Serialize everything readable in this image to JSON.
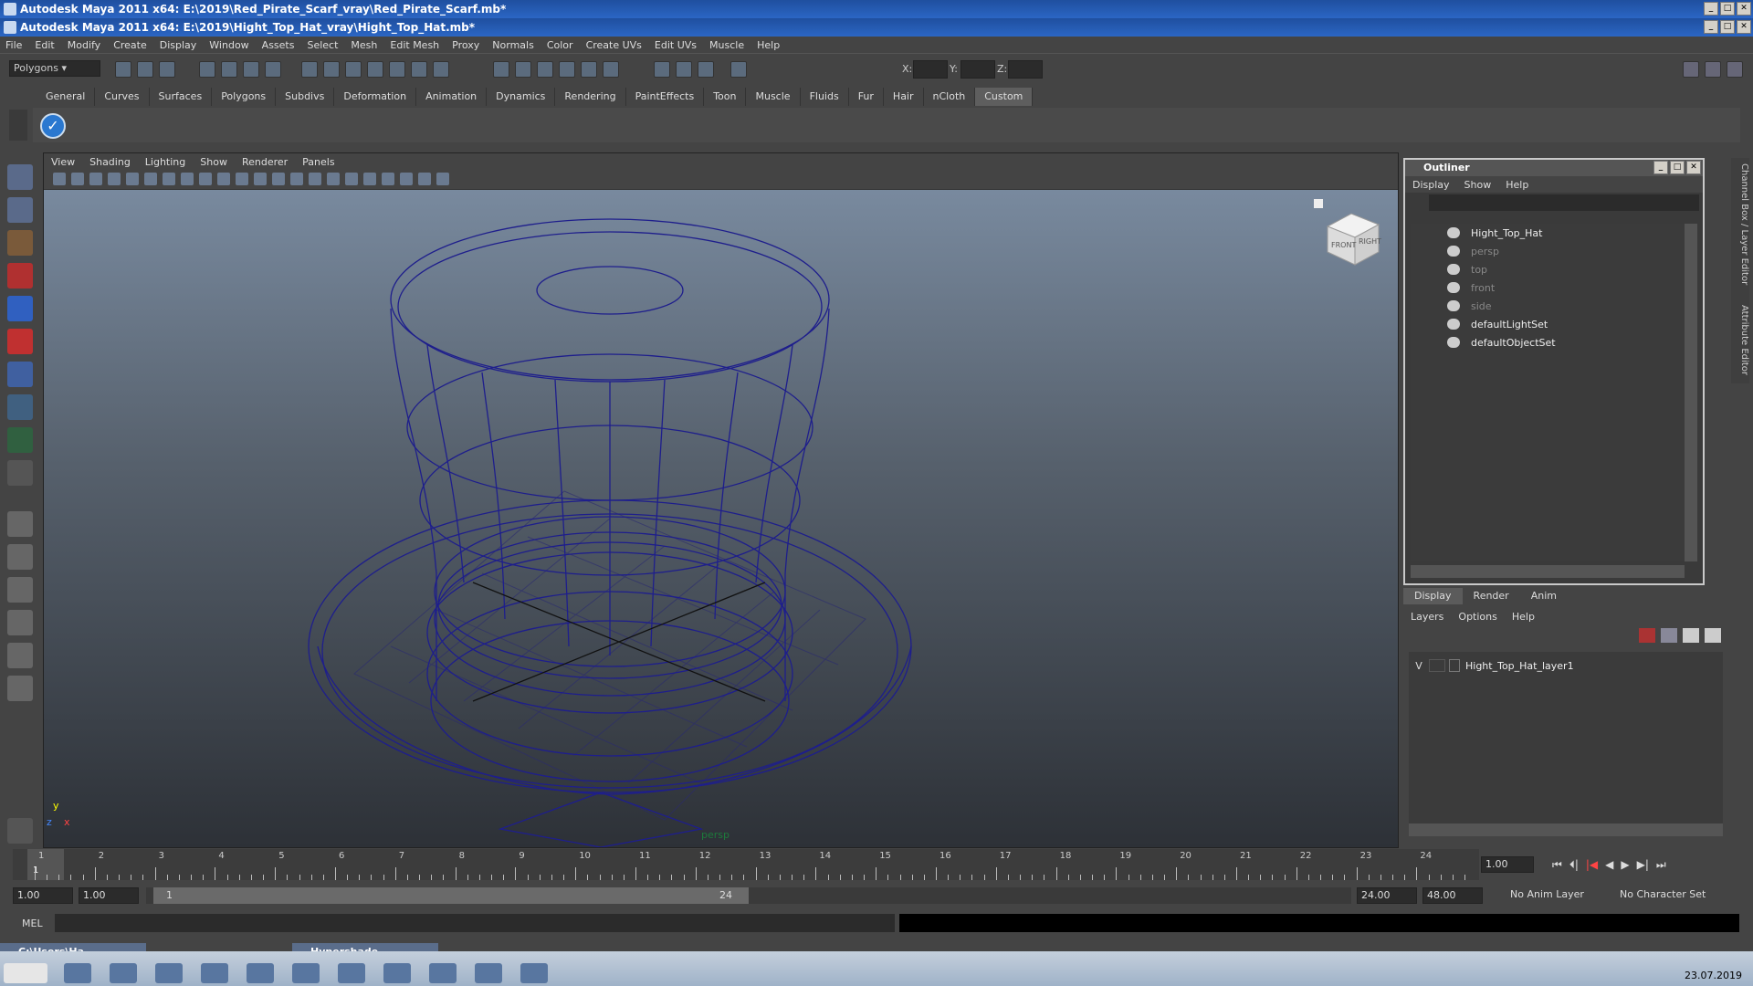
{
  "window": {
    "bg_title": "Autodesk Maya 2011 x64: E:\\2019\\Red_Pirate_Scarf_vray\\Red_Pirate_Scarf.mb*",
    "title": "Autodesk Maya 2011 x64: E:\\2019\\Hight_Top_Hat_vray\\Hight_Top_Hat.mb*"
  },
  "menu": [
    "File",
    "Edit",
    "Modify",
    "Create",
    "Display",
    "Window",
    "Assets",
    "Select",
    "Mesh",
    "Edit Mesh",
    "Proxy",
    "Normals",
    "Color",
    "Create UVs",
    "Edit UVs",
    "Muscle",
    "Help"
  ],
  "toolbar": {
    "mode": "Polygons",
    "x_label": "X:",
    "y_label": "Y:",
    "z_label": "Z:"
  },
  "shelf_tabs": [
    "General",
    "Curves",
    "Surfaces",
    "Polygons",
    "Subdivs",
    "Deformation",
    "Animation",
    "Dynamics",
    "Rendering",
    "PaintEffects",
    "Toon",
    "Muscle",
    "Fluids",
    "Fur",
    "Hair",
    "nCloth",
    "Custom"
  ],
  "viewport": {
    "menu": [
      "View",
      "Shading",
      "Lighting",
      "Show",
      "Renderer",
      "Panels"
    ],
    "camera_label": "persp",
    "cube_front": "FRONT",
    "cube_right": "RIGHT",
    "axis_y": "y",
    "axis_x": "x",
    "axis_z": "z"
  },
  "outliner": {
    "title": "Outliner",
    "menu": [
      "Display",
      "Show",
      "Help"
    ],
    "items": [
      "Hight_Top_Hat",
      "persp",
      "top",
      "front",
      "side",
      "defaultLightSet",
      "defaultObjectSet"
    ]
  },
  "side_tabs": {
    "channel": "Channel Box / Layer Editor",
    "attribute": "Attribute Editor"
  },
  "layers": {
    "tabs": [
      "Display",
      "Render",
      "Anim"
    ],
    "menu": [
      "Layers",
      "Options",
      "Help"
    ],
    "visible_flag": "V",
    "layer_name": "Hight_Top_Hat_layer1"
  },
  "timeline": {
    "ticks": [
      "1",
      "2",
      "3",
      "4",
      "5",
      "6",
      "7",
      "8",
      "9",
      "10",
      "11",
      "12",
      "13",
      "14",
      "15",
      "16",
      "17",
      "18",
      "19",
      "20",
      "21",
      "22",
      "23",
      "24"
    ],
    "current_frame": "1.00",
    "current_marker": "1"
  },
  "range": {
    "start": "1.00",
    "playback_start": "1.00",
    "slider_start": "1",
    "slider_end": "24",
    "playback_end": "24.00",
    "end": "48.00",
    "anim_layer": "No Anim Layer",
    "character_set": "No Character Set"
  },
  "command_line": {
    "label": "MEL"
  },
  "minimized": {
    "explorer": "C:\\Users\\Ha...",
    "hypershade": "Hypershade"
  },
  "taskbar": {
    "date": "23.07.2019"
  },
  "colors": {
    "wire": "#1e1e8c",
    "accent_title": "#2b66c4",
    "panel": "#444444"
  }
}
